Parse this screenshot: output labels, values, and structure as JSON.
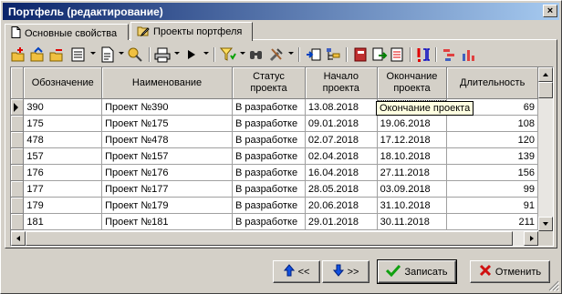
{
  "window": {
    "title": "Портфель (редактирование)",
    "close_glyph": "×"
  },
  "tabs": [
    {
      "label": "Основные свойства",
      "icon": "document-icon"
    },
    {
      "label": "Проекты портфеля",
      "icon": "folder-edit-icon"
    }
  ],
  "grid": {
    "columns": [
      "Обозначение",
      "Наименование",
      "Статус проекта",
      "Начало проекта",
      "Окончание проекта",
      "Длительность"
    ],
    "rows": [
      [
        "390",
        "Проект №390",
        "В разработке",
        "13.08.2018",
        "",
        "69"
      ],
      [
        "175",
        "Проект №175",
        "В разработке",
        "09.01.2018",
        "19.06.2018",
        "108"
      ],
      [
        "478",
        "Проект №478",
        "В разработке",
        "02.07.2018",
        "17.12.2018",
        "120"
      ],
      [
        "157",
        "Проект №157",
        "В разработке",
        "02.04.2018",
        "18.10.2018",
        "139"
      ],
      [
        "176",
        "Проект №176",
        "В разработке",
        "16.04.2018",
        "27.11.2018",
        "156"
      ],
      [
        "177",
        "Проект №177",
        "В разработке",
        "28.05.2018",
        "03.09.2018",
        "99"
      ],
      [
        "179",
        "Проект №179",
        "В разработке",
        "20.06.2018",
        "31.10.2018",
        "91"
      ],
      [
        "181",
        "Проект №181",
        "В разработке",
        "29.01.2018",
        "30.11.2018",
        "211"
      ]
    ],
    "tooltip": "Окончание проекта"
  },
  "buttons": {
    "move_up": "<<",
    "move_down": ">>",
    "save": "Записать",
    "cancel": "Отменить"
  },
  "colors": {
    "title_start": "#0a246a",
    "title_end": "#a6caf0",
    "face": "#d4d0c8",
    "tooltip": "#ffffe1"
  }
}
